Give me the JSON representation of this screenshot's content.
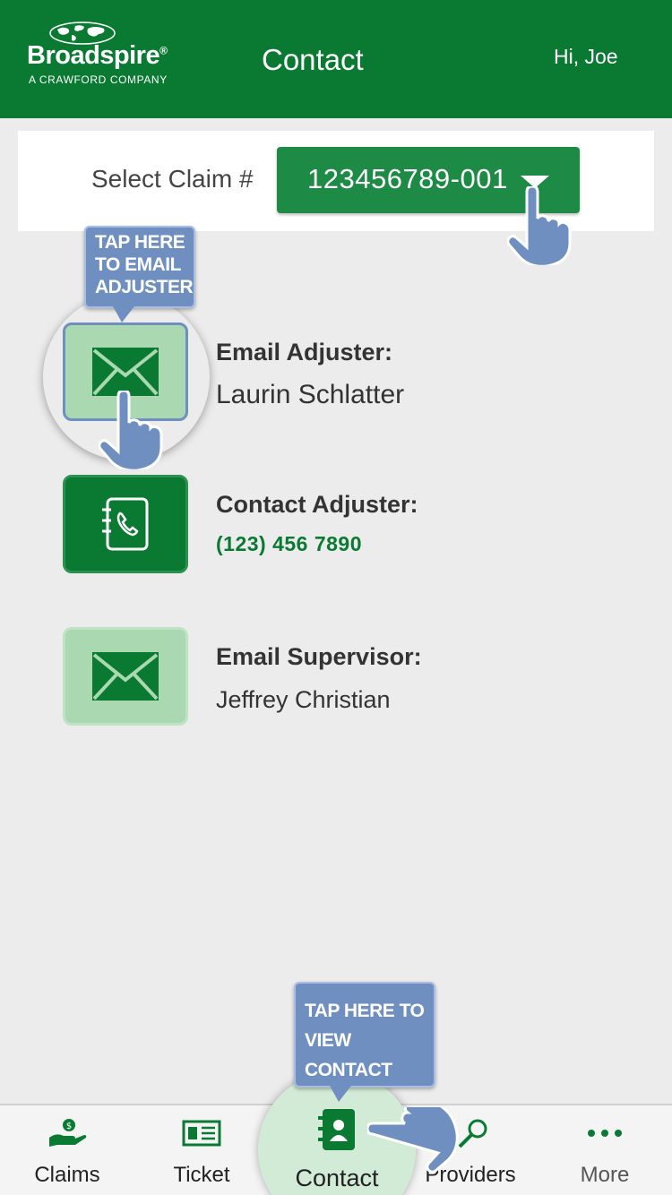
{
  "header": {
    "logo_name": "Broadspire",
    "logo_registered": "®",
    "logo_tagline": "A CRAWFORD COMPANY",
    "title": "Contact",
    "greeting": "Hi, Joe"
  },
  "claim": {
    "label": "Select Claim #",
    "selected": "123456789-001"
  },
  "contacts": [
    {
      "label": "Email Adjuster:",
      "value": "Laurin Schlatter",
      "icon": "mail-icon"
    },
    {
      "label": "Contact Adjuster:",
      "value": "(123) 456 7890",
      "icon": "phone-book-icon"
    },
    {
      "label": "Email Supervisor:",
      "value": "Jeffrey Christian",
      "icon": "mail-icon"
    }
  ],
  "callouts": {
    "email": "TAP HERE TO EMAIL ADJUSTER",
    "contact": "TAP HERE TO VIEW CONTACT"
  },
  "tabs": [
    {
      "label": "Claims",
      "icon": "hand-coin-icon"
    },
    {
      "label": "Ticket",
      "icon": "ticket-icon"
    },
    {
      "label": "Contact",
      "icon": "contact-book-icon",
      "active": true
    },
    {
      "label": "Providers",
      "icon": "magnifier-icon"
    },
    {
      "label": "More",
      "icon": "more-dots-icon"
    }
  ],
  "colors": {
    "brand_green": "#0a7a32",
    "select_green": "#1d8a45",
    "icon_light_green": "#a9d8b1",
    "callout_blue": "#6f8fc0",
    "background": "#ececec"
  }
}
